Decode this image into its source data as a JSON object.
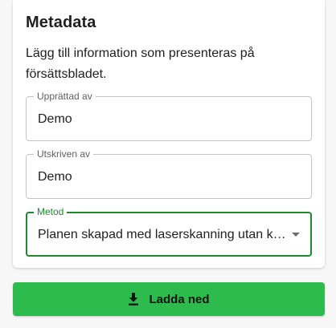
{
  "metadata": {
    "title": "Metadata",
    "description": "Lägg till information som presenteras på försättsbladet.",
    "fields": [
      {
        "label": "Upprättad av",
        "value": "Demo"
      },
      {
        "label": "Utskriven av",
        "value": "Demo"
      }
    ],
    "method": {
      "label": "Metod",
      "selected": "Planen skapad med laserskanning utan kontroll",
      "icon": "chevron-down-icon"
    }
  },
  "download_button": {
    "label": "Ladda ned",
    "icon": "download-icon"
  },
  "colors": {
    "accent": "#1e8a2d",
    "button": "#2dbb4e"
  }
}
